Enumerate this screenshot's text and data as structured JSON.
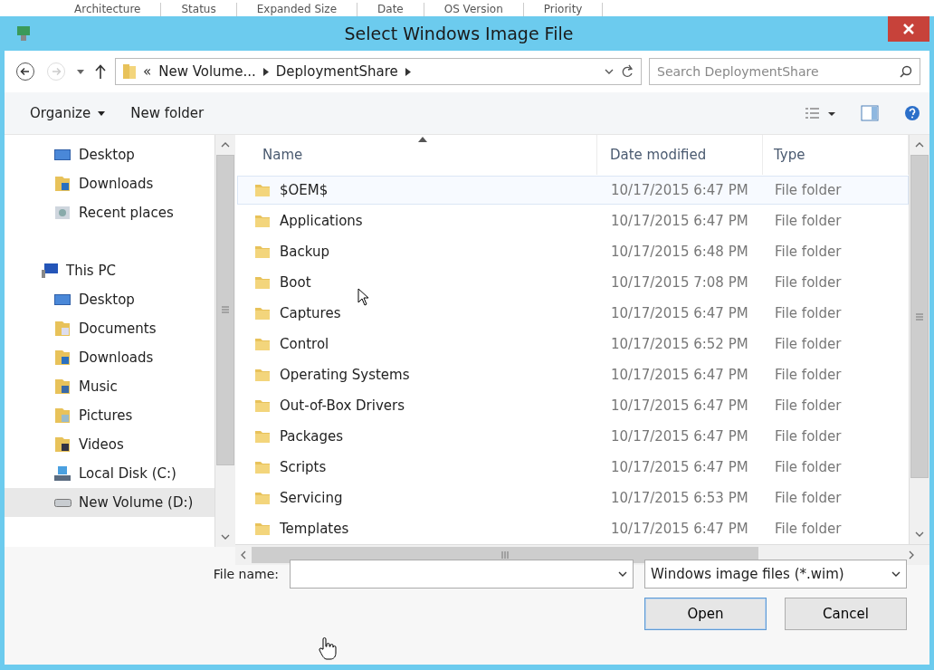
{
  "background_columns": [
    "Architecture",
    "Status",
    "Expanded Size",
    "Date",
    "OS Version",
    "Priority"
  ],
  "window": {
    "title": "Select Windows Image File"
  },
  "address": {
    "prefix": "«",
    "crumbs": [
      "New Volume...",
      "DeploymentShare"
    ],
    "search_placeholder": "Search DeploymentShare"
  },
  "toolbar": {
    "organize": "Organize",
    "new_folder": "New folder"
  },
  "nav": {
    "quick": [
      {
        "label": "Desktop",
        "kind": "desktop",
        "selected": false
      },
      {
        "label": "Downloads",
        "kind": "downloads",
        "selected": false
      },
      {
        "label": "Recent places",
        "kind": "recent",
        "selected": false
      }
    ],
    "pc": {
      "label": "This PC",
      "kind": "pc",
      "selected": false,
      "children": [
        {
          "label": "Desktop",
          "kind": "desktop",
          "selected": false
        },
        {
          "label": "Documents",
          "kind": "documents",
          "selected": false
        },
        {
          "label": "Downloads",
          "kind": "downloads",
          "selected": false
        },
        {
          "label": "Music",
          "kind": "music",
          "selected": false
        },
        {
          "label": "Pictures",
          "kind": "pictures",
          "selected": false
        },
        {
          "label": "Videos",
          "kind": "videos",
          "selected": false
        },
        {
          "label": "Local Disk (C:)",
          "kind": "disk",
          "selected": false
        },
        {
          "label": "New Volume (D:)",
          "kind": "drive",
          "selected": true
        }
      ]
    }
  },
  "table": {
    "columns": [
      "Name",
      "Date modified",
      "Type"
    ],
    "rows": [
      {
        "name": "$OEM$",
        "date": "10/17/2015 6:47 PM",
        "type": "File folder",
        "selected": true
      },
      {
        "name": "Applications",
        "date": "10/17/2015 6:47 PM",
        "type": "File folder",
        "selected": false
      },
      {
        "name": "Backup",
        "date": "10/17/2015 6:48 PM",
        "type": "File folder",
        "selected": false
      },
      {
        "name": "Boot",
        "date": "10/17/2015 7:08 PM",
        "type": "File folder",
        "selected": false
      },
      {
        "name": "Captures",
        "date": "10/17/2015 6:47 PM",
        "type": "File folder",
        "selected": false
      },
      {
        "name": "Control",
        "date": "10/17/2015 6:52 PM",
        "type": "File folder",
        "selected": false
      },
      {
        "name": "Operating Systems",
        "date": "10/17/2015 6:47 PM",
        "type": "File folder",
        "selected": false
      },
      {
        "name": "Out-of-Box Drivers",
        "date": "10/17/2015 6:47 PM",
        "type": "File folder",
        "selected": false
      },
      {
        "name": "Packages",
        "date": "10/17/2015 6:47 PM",
        "type": "File folder",
        "selected": false
      },
      {
        "name": "Scripts",
        "date": "10/17/2015 6:47 PM",
        "type": "File folder",
        "selected": false
      },
      {
        "name": "Servicing",
        "date": "10/17/2015 6:53 PM",
        "type": "File folder",
        "selected": false
      },
      {
        "name": "Templates",
        "date": "10/17/2015 6:47 PM",
        "type": "File folder",
        "selected": false
      }
    ]
  },
  "footer": {
    "file_name_label": "File name:",
    "file_type": "Windows image files (*.wim)",
    "open": "Open",
    "cancel": "Cancel"
  }
}
